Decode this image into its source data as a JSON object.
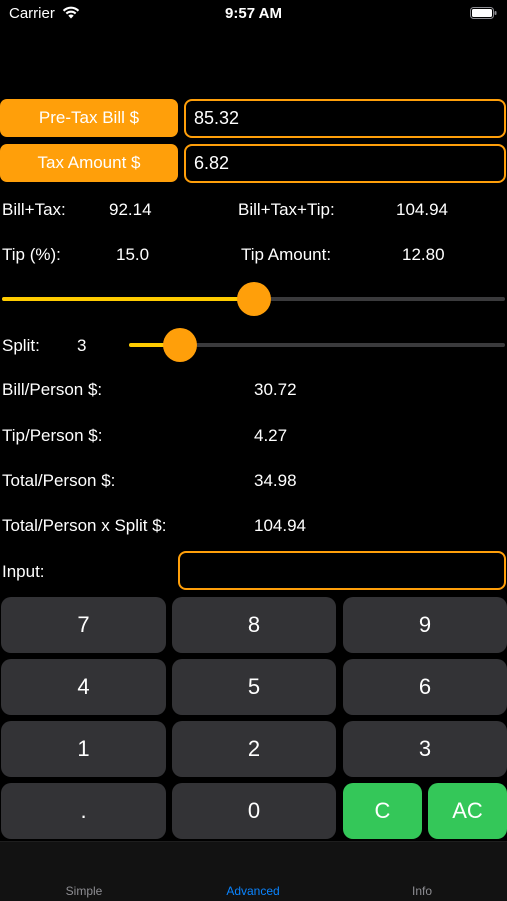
{
  "status_bar": {
    "carrier": "Carrier",
    "time": "9:57 AM",
    "icons": [
      "wifi-icon",
      "battery-icon"
    ]
  },
  "bill": {
    "pretax_label": "Pre-Tax Bill $",
    "pretax_value": "85.32",
    "tax_label": "Tax Amount $",
    "tax_value": "6.82"
  },
  "summary": {
    "bill_tax_label": "Bill+Tax:",
    "bill_tax_value": "92.14",
    "bill_tax_tip_label": "Bill+Tax+Tip:",
    "bill_tax_tip_value": "104.94",
    "tip_pct_label": "Tip (%):",
    "tip_pct_value": "15.0",
    "tip_amount_label": "Tip Amount:",
    "tip_amount_value": "12.80"
  },
  "tip_slider": {
    "level": 0.5
  },
  "split": {
    "label": "Split:",
    "value": "3",
    "slider_level": 0.1
  },
  "per_person": {
    "bill_label": "Bill/Person $:",
    "bill_value": "30.72",
    "tip_label": "Tip/Person $:",
    "tip_value": "4.27",
    "total_label": "Total/Person $:",
    "total_value": "34.98",
    "total_split_label": "Total/Person x Split $:",
    "total_split_value": "104.94"
  },
  "input": {
    "label": "Input:",
    "value": ""
  },
  "keypad": {
    "k7": "7",
    "k8": "8",
    "k9": "9",
    "k4": "4",
    "k5": "5",
    "k6": "6",
    "k1": "1",
    "k2": "2",
    "k3": "3",
    "kdot": ".",
    "k0": "0",
    "kc": "C",
    "kac": "AC"
  },
  "tabs": {
    "simple": "Simple",
    "advanced": "Advanced",
    "info": "Info",
    "active": "advanced"
  },
  "colors": {
    "accent_orange": "#ff9f0a",
    "slider_yellow": "#ffcc00",
    "key_gray": "#333336",
    "key_green": "#34c759",
    "tab_active": "#0a84ff"
  }
}
